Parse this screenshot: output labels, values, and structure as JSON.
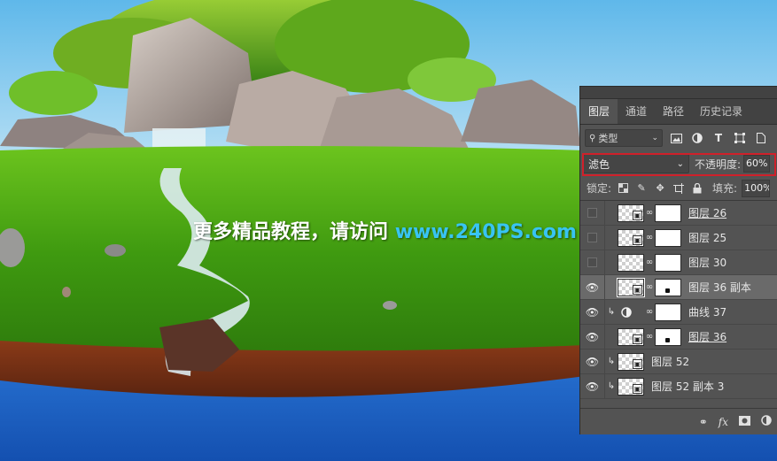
{
  "watermark": {
    "text_cn": "更多精品教程，请访问",
    "url": "www.240PS.com"
  },
  "panel": {
    "tabs": [
      {
        "label": "图层",
        "active": true
      },
      {
        "label": "通道",
        "active": false
      },
      {
        "label": "路径",
        "active": false
      },
      {
        "label": "历史记录",
        "active": false
      }
    ],
    "filter_kind": "类型",
    "filter_icons": [
      "image-filter-icon",
      "adjustment-filter-icon",
      "type-filter-icon",
      "shape-filter-icon",
      "smart-object-filter-icon"
    ],
    "blend_mode": "滤色",
    "opacity_label": "不透明度:",
    "opacity_value": "60%",
    "lock_label": "锁定:",
    "lock_icons": [
      "lock-transparent-icon",
      "lock-paint-icon",
      "lock-move-icon",
      "lock-artboard-icon",
      "lock-all-icon"
    ],
    "fill_label": "填充:",
    "fill_value": "100%",
    "layers": [
      {
        "name": "图层 26",
        "visible": false,
        "clipped": false,
        "type": "image",
        "has_mask": true,
        "selected": false,
        "underline": true
      },
      {
        "name": "图层 25",
        "visible": false,
        "clipped": false,
        "type": "image",
        "has_mask": true,
        "selected": false,
        "underline": false
      },
      {
        "name": "图层 30",
        "visible": false,
        "clipped": false,
        "type": "plain",
        "has_mask": true,
        "selected": false,
        "underline": false
      },
      {
        "name": "图层 36 副本",
        "visible": true,
        "clipped": false,
        "type": "image",
        "has_mask": true,
        "selected": true,
        "underline": false
      },
      {
        "name": "曲线 37",
        "visible": true,
        "clipped": true,
        "type": "adjustment",
        "has_mask": true,
        "selected": false,
        "underline": false
      },
      {
        "name": "图层 36",
        "visible": true,
        "clipped": false,
        "type": "image",
        "has_mask": true,
        "selected": false,
        "underline": true
      },
      {
        "name": "图层 52",
        "visible": true,
        "clipped": true,
        "type": "image",
        "has_mask": false,
        "selected": false,
        "underline": false
      },
      {
        "name": "图层 52 副本 3",
        "visible": true,
        "clipped": true,
        "type": "image",
        "has_mask": false,
        "selected": false,
        "underline": false
      }
    ],
    "footer_icons": [
      "link-layers-icon",
      "fx-icon",
      "add-mask-icon",
      "new-adjustment-icon"
    ],
    "footer_fx": "fx"
  },
  "colors": {
    "sky": "#4aa8e0",
    "grass": "#3d9a12",
    "soil": "#7a3418",
    "ground_blue": "#1a5cc0",
    "panel_bg": "#535353",
    "highlight": "#d0202a",
    "url_blue": "#38c4f2"
  }
}
